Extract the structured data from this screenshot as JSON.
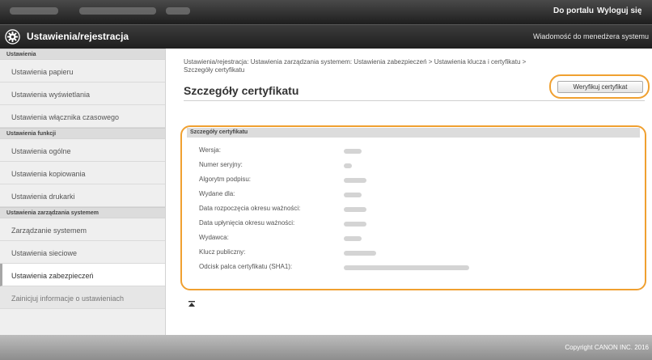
{
  "topbar": {
    "portal_link": "Do portalu",
    "logout_link": "Wyloguj się"
  },
  "header": {
    "title": "Ustawienia/rejestracja",
    "admin_message": "Wiadomość do menedżera systemu",
    "icon": "gear-icon"
  },
  "sidebar": {
    "sections": [
      {
        "heading": "Ustawienia",
        "items": [
          "Ustawienia papieru",
          "Ustawienia wyświetlania",
          "Ustawienia włącznika czasowego"
        ]
      },
      {
        "heading": "Ustawienia funkcji",
        "items": [
          "Ustawienia ogólne",
          "Ustawienia kopiowania",
          "Ustawienia drukarki"
        ]
      },
      {
        "heading": "Ustawienia zarządzania systemem",
        "items": [
          "Zarządzanie systemem",
          "Ustawienia sieciowe",
          "Ustawienia zabezpieczeń",
          "Zainicjuj informacje o ustawieniach"
        ]
      }
    ],
    "active_item": "Ustawienia zabezpieczeń"
  },
  "main": {
    "breadcrumb_line1": "Ustawienia/rejestracja: Ustawienia zarządzania systemem: Ustawienia zabezpieczeń > Ustawienia klucza i certyfikatu >",
    "breadcrumb_line2": "Szczegóły certyfikatu",
    "page_title": "Szczegóły certyfikatu",
    "verify_button": "Weryfikuj certyfikat",
    "details_heading": "Szczegóły certyfikatu",
    "rows": [
      "Wersja:",
      "Numer seryjny:",
      "Algorytm podpisu:",
      "Wydane dla:",
      "Data rozpoczęcia okresu ważności:",
      "Data upłynięcia okresu ważności:",
      "Wydawca:",
      "Klucz publiczny:",
      "Odcisk palca certyfikatu (SHA1):"
    ]
  },
  "footer": {
    "copyright": "Copyright CANON INC. 2016"
  },
  "colors": {
    "highlight": "#f0a030",
    "topbar": "#2a2a2a"
  }
}
